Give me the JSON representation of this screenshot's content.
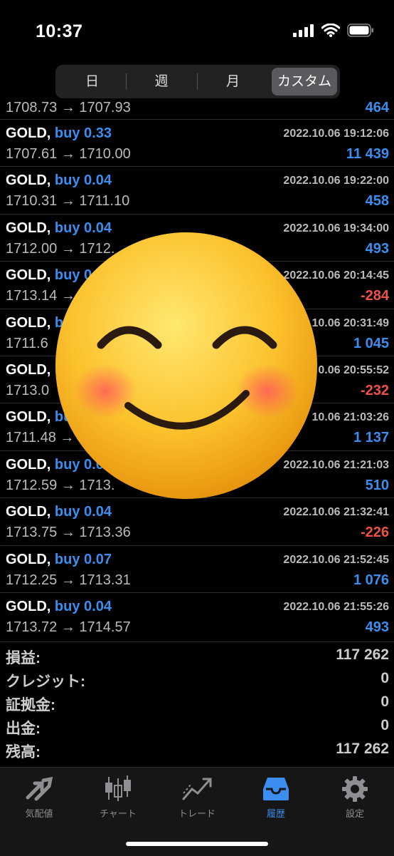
{
  "status_bar": {
    "time": "10:37"
  },
  "period_tabs": [
    {
      "label": "日",
      "active": false
    },
    {
      "label": "週",
      "active": false
    },
    {
      "label": "月",
      "active": false
    },
    {
      "label": "カスタム",
      "active": true
    }
  ],
  "partial_row": {
    "prices": "1708.73 → 1707.93",
    "profit": "464"
  },
  "deals": [
    {
      "symbol": "GOLD,",
      "side": "buy 0.33",
      "date": "2022.10.06 19:12:06",
      "prices": "1707.61 → 1710.00",
      "profit": "11 439",
      "negative": false
    },
    {
      "symbol": "GOLD,",
      "side": "buy 0.04",
      "date": "2022.10.06 19:22:00",
      "prices": "1710.31 → 1711.10",
      "profit": "458",
      "negative": false
    },
    {
      "symbol": "GOLD,",
      "side": "buy 0.04",
      "date": "2022.10.06 19:34:00",
      "prices": "1712.00 → 1712.",
      "profit": "493",
      "negative": false
    },
    {
      "symbol": "GOLD,",
      "side": "buy 0.0",
      "date": "2022.10.06 20:14:45",
      "prices": "1713.14 →",
      "profit": "-284",
      "negative": true
    },
    {
      "symbol": "GOLD,",
      "side": "bu",
      "date": "10.06 20:31:49",
      "prices": "1711.6",
      "profit": "1 045",
      "negative": false
    },
    {
      "symbol": "GOLD,",
      "side": "b",
      "date": "0.06 20:55:52",
      "prices": "1713.0",
      "profit": "-232",
      "negative": true
    },
    {
      "symbol": "GOLD,",
      "side": "bu",
      "date": "10.06 21:03:26",
      "prices": "1711.48 →",
      "profit": "1 137",
      "negative": false
    },
    {
      "symbol": "GOLD,",
      "side": "buy 0.04",
      "date": "2022.10.06 21:21:03",
      "prices": "1712.59 → 1713.",
      "profit": "510",
      "negative": false
    },
    {
      "symbol": "GOLD,",
      "side": "buy 0.04",
      "date": "2022.10.06 21:32:41",
      "prices": "1713.75 → 1713.36",
      "profit": "-226",
      "negative": true
    },
    {
      "symbol": "GOLD,",
      "side": "buy 0.07",
      "date": "2022.10.06 21:52:45",
      "prices": "1712.25 → 1713.31",
      "profit": "1 076",
      "negative": false
    },
    {
      "symbol": "GOLD,",
      "side": "buy 0.04",
      "date": "2022.10.06 21:55:26",
      "prices": "1713.72 → 1714.57",
      "profit": "493",
      "negative": false
    }
  ],
  "summary": [
    {
      "label": "損益:",
      "value": "117 262"
    },
    {
      "label": "クレジット:",
      "value": "0"
    },
    {
      "label": "証拠金:",
      "value": "0"
    },
    {
      "label": "出金:",
      "value": "0"
    },
    {
      "label": "残高:",
      "value": "117 262"
    }
  ],
  "tabbar": [
    {
      "label": "気配値",
      "icon": "arrows-icon",
      "active": false
    },
    {
      "label": "チャート",
      "icon": "candlestick-icon",
      "active": false
    },
    {
      "label": "トレード",
      "icon": "trend-icon",
      "active": false
    },
    {
      "label": "履歴",
      "icon": "inbox-icon",
      "active": true
    },
    {
      "label": "設定",
      "icon": "gear-icon",
      "active": false
    }
  ],
  "overlay": {
    "icon": "smiling-face-emoji"
  },
  "colors": {
    "profit": "#3b8ef0",
    "loss": "#f0504a",
    "active_tab": "#3b8ef0"
  }
}
